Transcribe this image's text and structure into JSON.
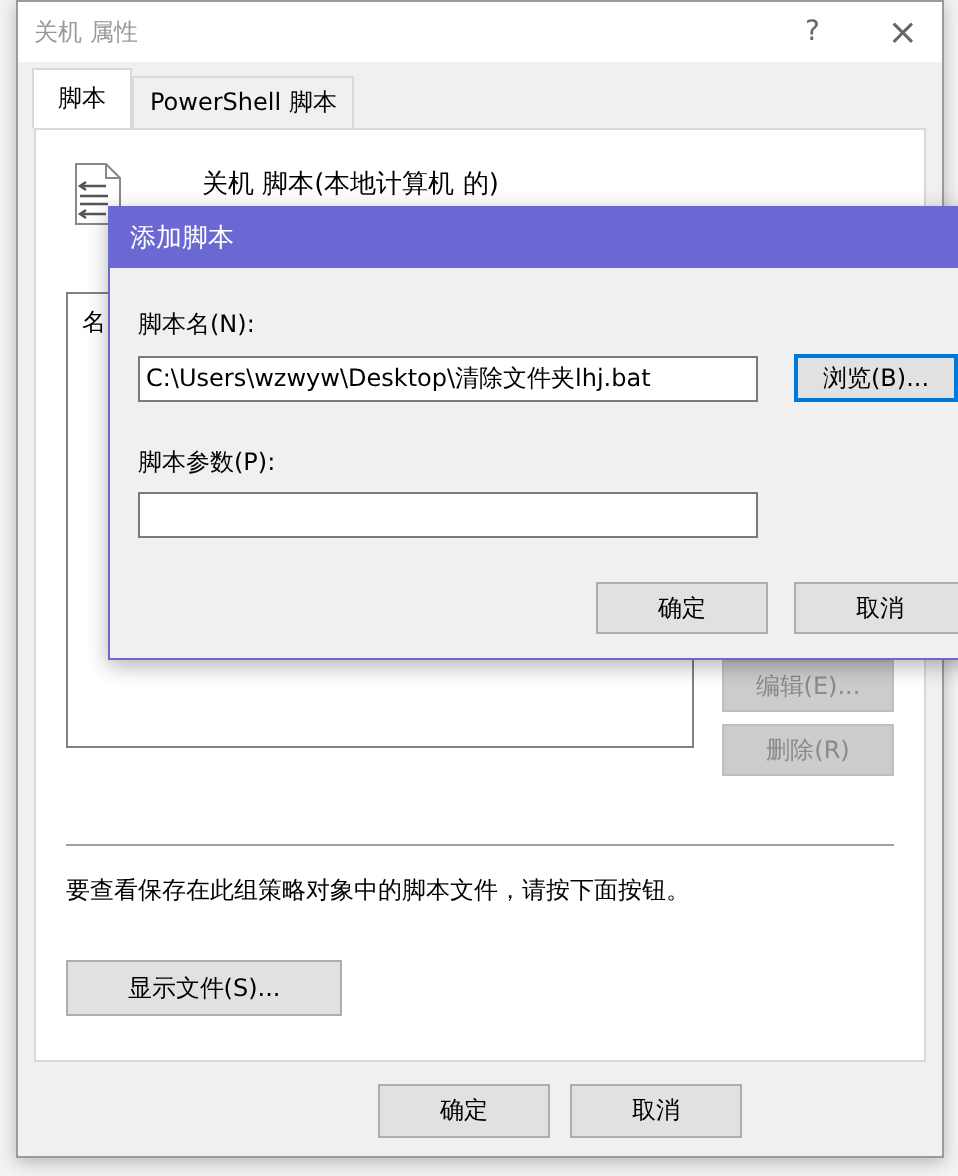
{
  "window": {
    "title": "关机 属性",
    "help": "?",
    "close": "×",
    "tabs": [
      {
        "label": "脚本",
        "selected": true
      },
      {
        "label": "PowerShell 脚本",
        "selected": false
      }
    ],
    "heading": "关机 脚本(本地计算机 的)",
    "list": {
      "column_1": "名"
    },
    "side_buttons": [
      {
        "label": "编辑(E)...",
        "disabled": true
      },
      {
        "label": "删除(R)",
        "disabled": true
      }
    ],
    "note": "要查看保存在此组策略对象中的脚本文件，请按下面按钮。",
    "show_files_button": "显示文件(S)...",
    "buttons": [
      "确定",
      "取消"
    ]
  },
  "dialog": {
    "title": "添加脚本",
    "fields": [
      {
        "label": "脚本名(N):",
        "value": "C:\\Users\\wzwyw\\Desktop\\清除文件夹lhj.bat",
        "browse": "浏览(B)..."
      },
      {
        "label": "脚本参数(P):"
      }
    ],
    "buttons": [
      "确定",
      "取消"
    ]
  }
}
